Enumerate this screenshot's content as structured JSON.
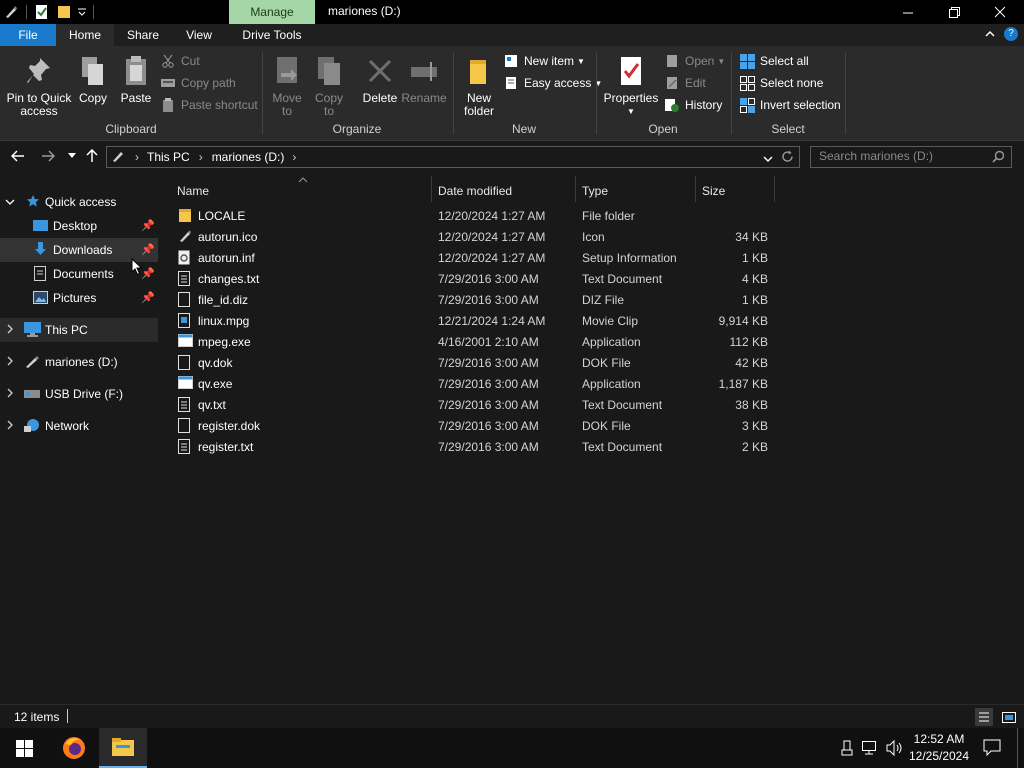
{
  "titlebar": {
    "context_tab": "Manage",
    "title": "mariones (D:)",
    "minimize": "—",
    "maximize": "❐",
    "close": "✕"
  },
  "ribbon_tabs": {
    "file": "File",
    "home": "Home",
    "share": "Share",
    "view": "View",
    "drive_tools": "Drive Tools"
  },
  "ribbon": {
    "clipboard": {
      "label": "Clipboard",
      "pin_line1": "Pin to Quick",
      "pin_line2": "access",
      "copy": "Copy",
      "paste": "Paste",
      "cut": "Cut",
      "copy_path": "Copy path",
      "paste_shortcut": "Paste shortcut"
    },
    "organize": {
      "label": "Organize",
      "move_line1": "Move",
      "move_line2": "to",
      "copy_line1": "Copy",
      "copy_line2": "to",
      "delete": "Delete",
      "rename": "Rename"
    },
    "new": {
      "label": "New",
      "folder_line1": "New",
      "folder_line2": "folder",
      "new_item": "New item",
      "easy_access": "Easy access"
    },
    "open": {
      "label": "Open",
      "properties": "Properties",
      "open": "Open",
      "edit": "Edit",
      "history": "History"
    },
    "select": {
      "label": "Select",
      "select_all": "Select all",
      "select_none": "Select none",
      "invert": "Invert selection"
    }
  },
  "address": {
    "crumbs": [
      "This PC",
      "mariones (D:)"
    ],
    "separator": "›",
    "search_placeholder": "Search mariones (D:)"
  },
  "sidebar": {
    "quick_access": "Quick access",
    "items": [
      "Desktop",
      "Downloads",
      "Documents",
      "Pictures"
    ],
    "this_pc": "This PC",
    "drive_d": "mariones (D:)",
    "usb": "USB Drive (F:)",
    "network": "Network"
  },
  "columns": {
    "name": "Name",
    "date": "Date modified",
    "type": "Type",
    "size": "Size"
  },
  "files": [
    {
      "name": "LOCALE",
      "date": "12/20/2024 1:27 AM",
      "type": "File folder",
      "size": "",
      "icon": "folder-icon"
    },
    {
      "name": "autorun.ico",
      "date": "12/20/2024 1:27 AM",
      "type": "Icon",
      "size": "34 KB",
      "icon": "pen-icon"
    },
    {
      "name": "autorun.inf",
      "date": "12/20/2024 1:27 AM",
      "type": "Setup Information",
      "size": "1 KB",
      "icon": "settings-file-icon"
    },
    {
      "name": "changes.txt",
      "date": "7/29/2016 3:00 AM",
      "type": "Text Document",
      "size": "4 KB",
      "icon": "text-file-icon"
    },
    {
      "name": "file_id.diz",
      "date": "7/29/2016 3:00 AM",
      "type": "DIZ File",
      "size": "1 KB",
      "icon": "blank-file-icon"
    },
    {
      "name": "linux.mpg",
      "date": "12/21/2024 1:24 AM",
      "type": "Movie Clip",
      "size": "9,914 KB",
      "icon": "movie-file-icon"
    },
    {
      "name": "mpeg.exe",
      "date": "4/16/2001 2:10 AM",
      "type": "Application",
      "size": "112 KB",
      "icon": "application-icon"
    },
    {
      "name": "qv.dok",
      "date": "7/29/2016 3:00 AM",
      "type": "DOK File",
      "size": "42 KB",
      "icon": "blank-file-icon"
    },
    {
      "name": "qv.exe",
      "date": "7/29/2016 3:00 AM",
      "type": "Application",
      "size": "1,187 KB",
      "icon": "application-icon"
    },
    {
      "name": "qv.txt",
      "date": "7/29/2016 3:00 AM",
      "type": "Text Document",
      "size": "38 KB",
      "icon": "text-file-icon"
    },
    {
      "name": "register.dok",
      "date": "7/29/2016 3:00 AM",
      "type": "DOK File",
      "size": "3 KB",
      "icon": "blank-file-icon"
    },
    {
      "name": "register.txt",
      "date": "7/29/2016 3:00 AM",
      "type": "Text Document",
      "size": "2 KB",
      "icon": "text-file-icon"
    }
  ],
  "status": {
    "item_count": "12 items"
  },
  "taskbar": {
    "time": "12:52 AM",
    "date": "12/25/2024"
  },
  "colors": {
    "accent": "#1979ca",
    "folder": "#f4c64a",
    "manage_tab": "#a5d6a7",
    "background": "#191919",
    "ribbon": "#2b2b2b"
  }
}
